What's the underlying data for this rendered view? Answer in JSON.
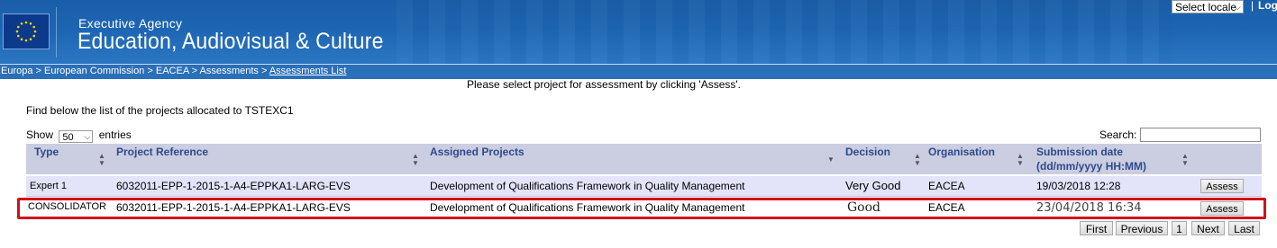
{
  "header": {
    "agency_line": "Executive Agency",
    "title": "Education, Audiovisual & Culture",
    "locale_select": "Select locale",
    "separator": "|",
    "login_label": "Log"
  },
  "breadcrumb": {
    "items": [
      "Europa",
      "European Commission",
      "EACEA",
      "Assessments",
      "Assessments List"
    ],
    "separator": " > "
  },
  "instruction": "Please select project for assessment by clicking 'Assess'.",
  "list_intro": "Find below the list of the projects allocated to TSTEXC1",
  "length_menu": {
    "prefix": "Show",
    "value": "50",
    "suffix": "entries"
  },
  "search": {
    "label": "Search:",
    "value": ""
  },
  "table": {
    "columns": [
      "Type",
      "Project Reference",
      "Assigned Projects",
      "Decision",
      "Organisation",
      "Submission date",
      "(dd/mm/yyyy HH:MM)"
    ],
    "rows": [
      {
        "type": "Expert 1",
        "reference": "6032011-EPP-1-2015-1-A4-EPPKA1-LARG-EVS",
        "project": "Development of Qualifications Framework in Quality Management",
        "decision": "Very Good",
        "organisation": "EACEA",
        "submission": "19/03/2018 12:28",
        "action": "Assess"
      },
      {
        "type": "CONSOLIDATOR",
        "reference": "6032011-EPP-1-2015-1-A4-EPPKA1-LARG-EVS",
        "project": "Development of Qualifications Framework in Quality Management",
        "decision": "Good",
        "organisation": "EACEA",
        "submission": "23/04/2018 16:34",
        "action": "Assess"
      }
    ]
  },
  "pagination": {
    "first": "First",
    "previous": "Previous",
    "page": "1",
    "next": "Next",
    "last": "Last"
  },
  "colors": {
    "header_blue": "#1d65b2",
    "header_row": "#cbcde0",
    "header_text": "#2d4a8c",
    "odd_row": "#e3e4fa",
    "highlight": "#d0101a"
  }
}
